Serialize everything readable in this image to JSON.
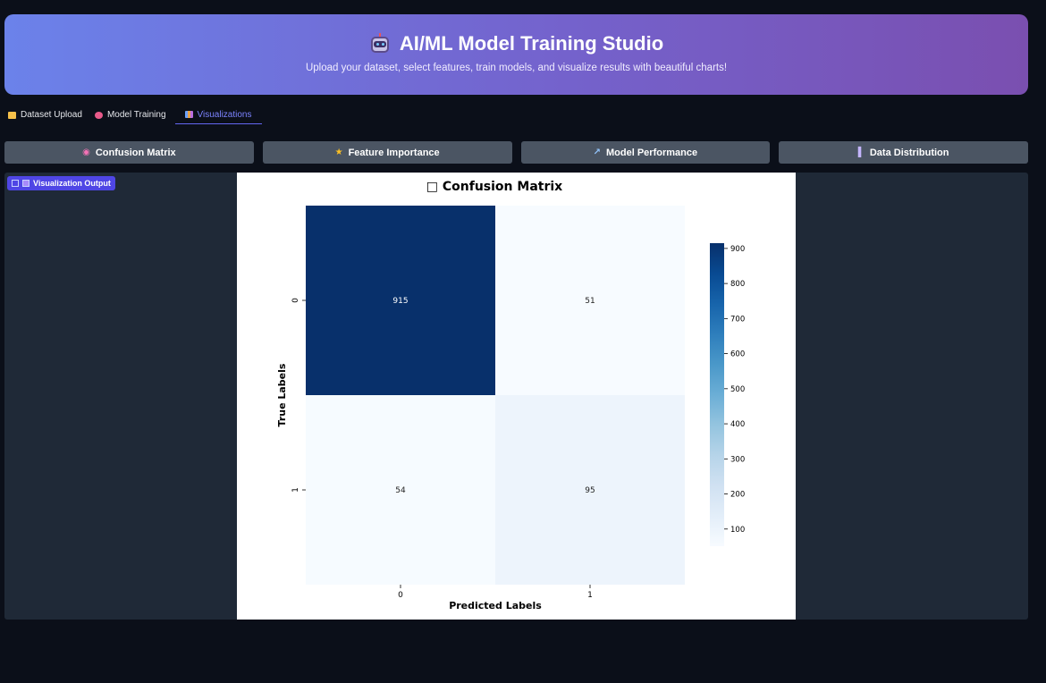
{
  "header": {
    "title": "AI/ML Model Training Studio",
    "subtitle": "Upload your dataset, select features, train models, and visualize results with beautiful charts!",
    "icon": "robot-icon"
  },
  "tabs": [
    {
      "label": "Dataset Upload",
      "icon": "folder-icon"
    },
    {
      "label": "Model Training",
      "icon": "target-icon"
    },
    {
      "label": "Visualizations",
      "icon": "bar-chart-icon",
      "active": true
    }
  ],
  "buttons": [
    {
      "label": "Confusion Matrix",
      "icon": "target-icon"
    },
    {
      "label": "Feature Importance",
      "icon": "star-icon"
    },
    {
      "label": "Model Performance",
      "icon": "line-chart-icon"
    },
    {
      "label": "Data Distribution",
      "icon": "bar-chart-icon"
    }
  ],
  "output": {
    "label": "Visualization Output"
  },
  "colors": {
    "accent": "#4f46e5",
    "panel": "#1f2937",
    "button": "#4b5563"
  },
  "chart_data": {
    "type": "heatmap",
    "title": "□ Confusion Matrix",
    "xlabel": "Predicted Labels",
    "ylabel": "True Labels",
    "x_categories": [
      "0",
      "1"
    ],
    "y_categories": [
      "0",
      "1"
    ],
    "values": [
      [
        915,
        51
      ],
      [
        54,
        95
      ]
    ],
    "colormap": "Blues",
    "colorbar": {
      "ticks": [
        100,
        200,
        300,
        400,
        500,
        600,
        700,
        800,
        900
      ],
      "range": [
        51,
        915
      ]
    }
  }
}
